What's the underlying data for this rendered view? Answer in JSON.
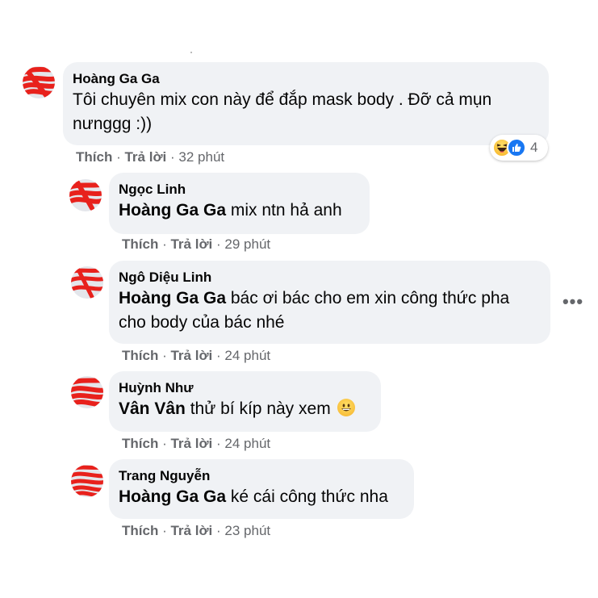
{
  "action_labels": {
    "like": "Thích",
    "reply": "Trả lời",
    "separator": "·"
  },
  "comments": [
    {
      "author": "Hoàng Ga Ga",
      "tag": "",
      "text": "Tôi chuyên mix con này để đắp mask body . Đỡ cả mụn\nnưnggg :))",
      "time": "32 phút",
      "reactions": {
        "icons": [
          "haha-icon",
          "like-icon"
        ],
        "count": "4"
      }
    },
    {
      "author": "Ngọc Linh",
      "tag": "Hoàng Ga Ga",
      "text": "mix ntn hả anh",
      "time": "29 phút"
    },
    {
      "author": "Ngô Diệu Linh",
      "tag": "Hoàng Ga Ga",
      "text": "bác ơi bác cho em xin công thức pha\ncho body của bác nhé",
      "time": "24 phút"
    },
    {
      "author": "Huỳnh Như",
      "tag": "Vân Vân",
      "text": "thử bí kíp này xem",
      "time": "24 phút",
      "emoji": "grinning-face-icon"
    },
    {
      "author": "Trang Nguyễn",
      "tag": "Hoàng Ga Ga",
      "text": "ké cái công thức nha",
      "time": "23 phút"
    }
  ],
  "more_options": "•••",
  "colors": {
    "bubble": "#f0f2f5",
    "meta": "#65676b",
    "text": "#050505",
    "like_blue": "#1877f2",
    "scribble_red": "#e8211c"
  }
}
